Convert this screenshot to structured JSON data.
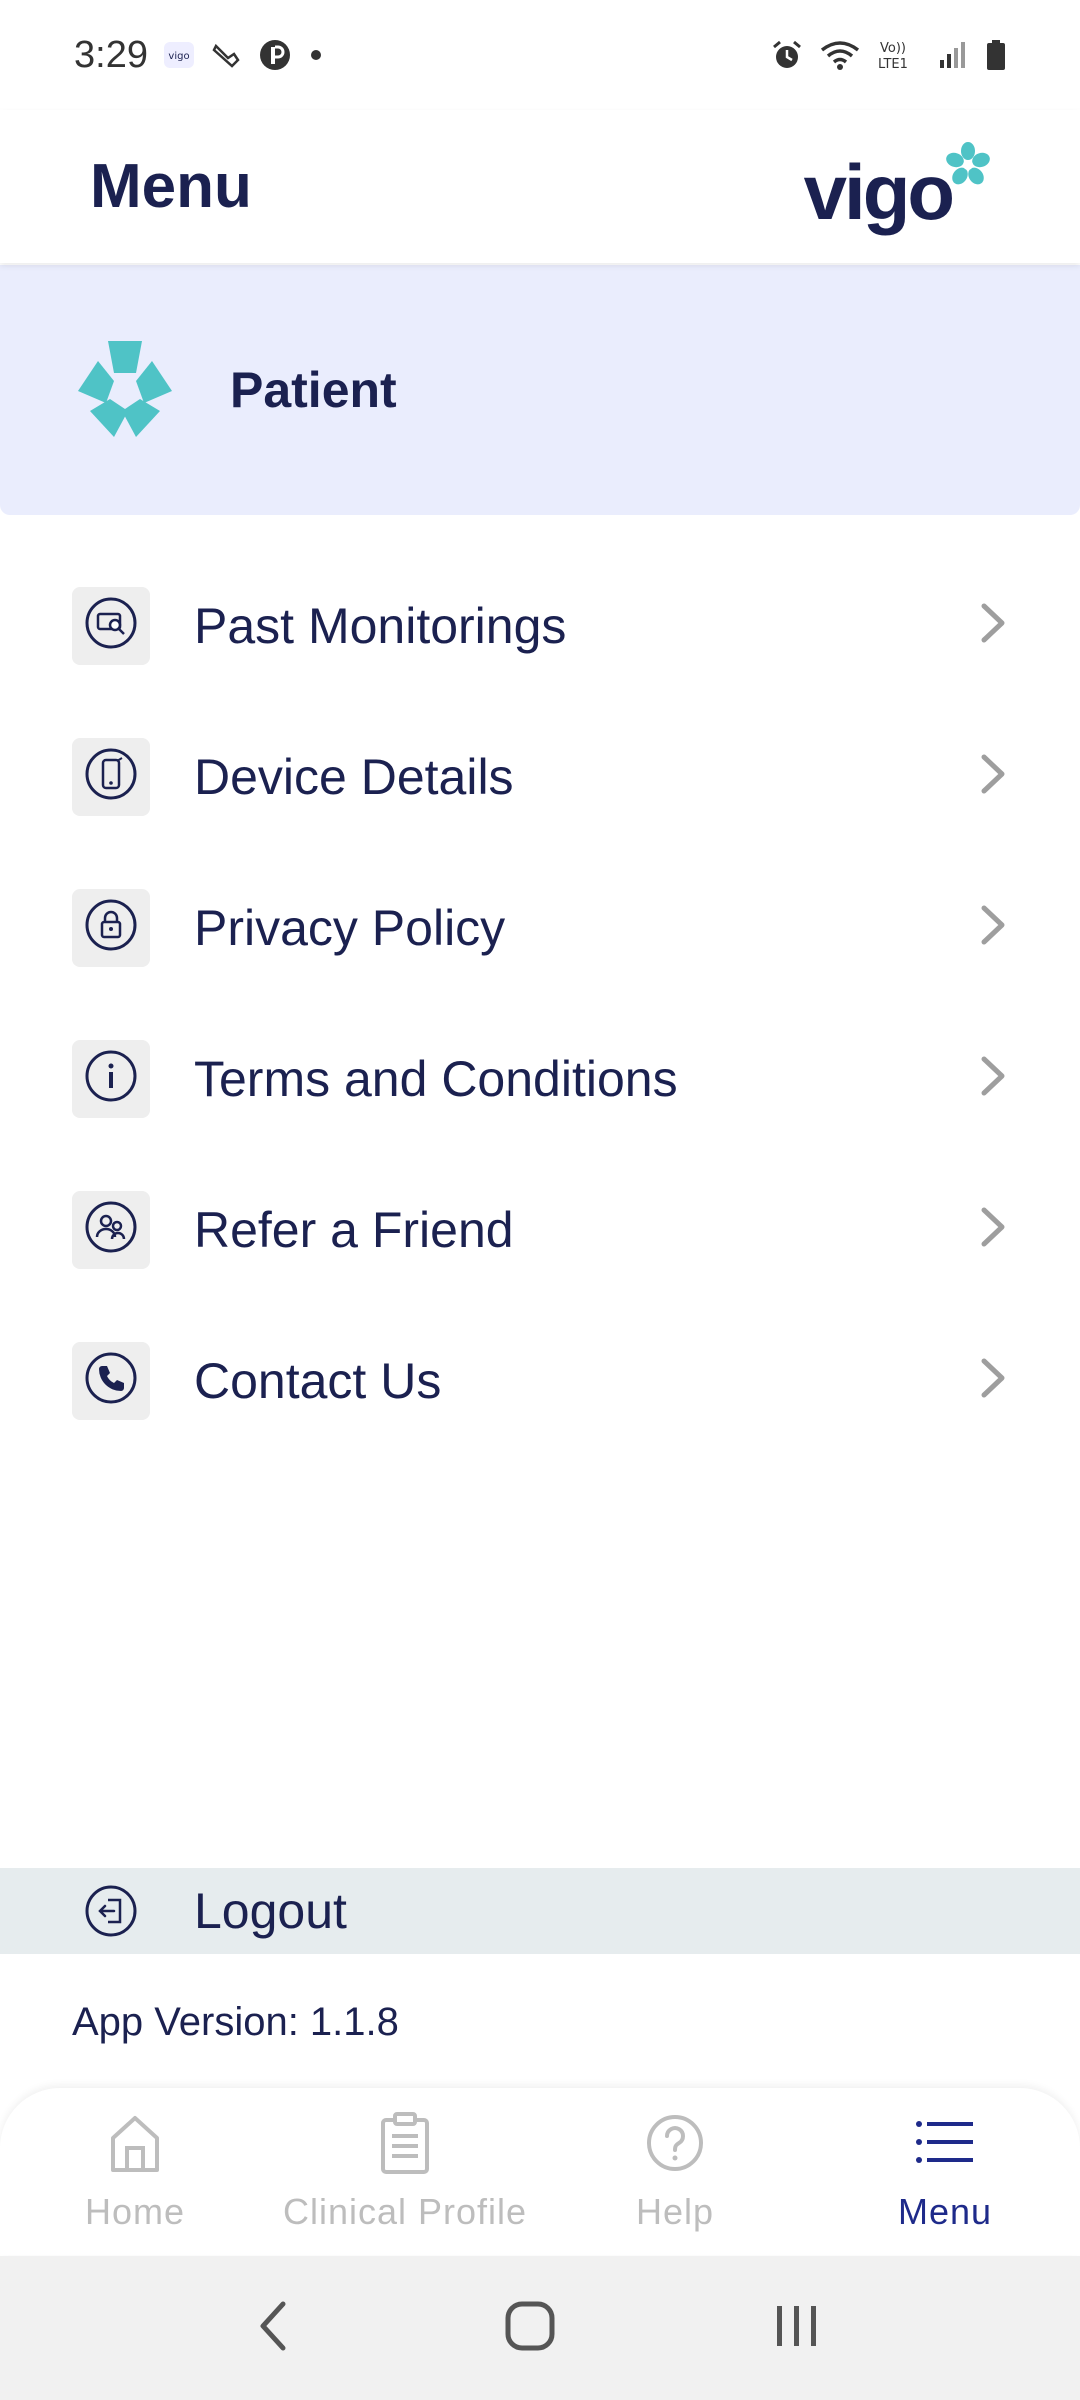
{
  "status_bar": {
    "time": "3:29",
    "notification_icons": [
      "vigo-app-icon",
      "phone-pen-icon",
      "p-circle-icon",
      "dot-icon"
    ],
    "system_icons": [
      "alarm-icon",
      "wifi-icon",
      "volte-icon",
      "signal-icon",
      "battery-icon"
    ],
    "volte_label": "Vo)) LTE1"
  },
  "header": {
    "title": "Menu",
    "brand": "vigo"
  },
  "profile": {
    "name": "Patient",
    "icon": "vigo-flower-icon"
  },
  "menu_items": [
    {
      "label": "Past Monitorings",
      "icon": "monitor-search-icon"
    },
    {
      "label": "Device Details",
      "icon": "phone-device-icon"
    },
    {
      "label": "Privacy Policy",
      "icon": "lock-icon"
    },
    {
      "label": "Terms and Conditions",
      "icon": "info-icon"
    },
    {
      "label": "Refer a Friend",
      "icon": "people-icon"
    },
    {
      "label": "Contact Us",
      "icon": "phone-icon"
    }
  ],
  "logout": {
    "label": "Logout",
    "icon": "logout-icon"
  },
  "app_version": "App Version: 1.1.8",
  "bottom_nav": [
    {
      "label": "Home",
      "icon": "home-icon",
      "active": false
    },
    {
      "label": "Clinical Profile",
      "icon": "clipboard-icon",
      "active": false
    },
    {
      "label": "Help",
      "icon": "help-icon",
      "active": false
    },
    {
      "label": "Menu",
      "icon": "menu-list-icon",
      "active": true
    }
  ],
  "colors": {
    "primary": "#1b2150",
    "accent": "#4fc3c6",
    "profile_bg": "#eaedfd",
    "logout_bg": "#e6ecee",
    "nav_active": "#1e2a8a",
    "nav_inactive": "#bdbdbd"
  }
}
